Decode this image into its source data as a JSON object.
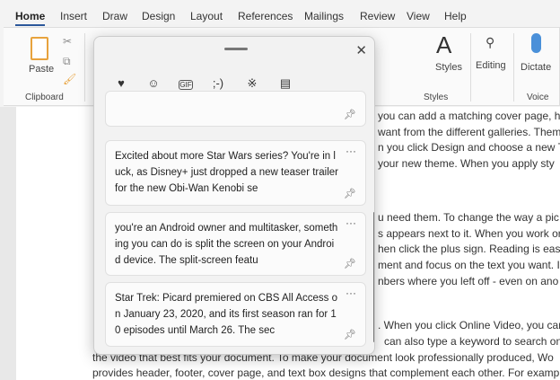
{
  "ribbon": {
    "tabs": [
      "Home",
      "Insert",
      "Draw",
      "Design",
      "Layout",
      "References",
      "Mailings",
      "Review",
      "View",
      "Help"
    ],
    "paste": "Paste",
    "clipboard": "Clipboard",
    "styles": "Styles",
    "styles_group": "Styles",
    "editing": "Editing",
    "dictate": "Dictate",
    "voice": "Voice"
  },
  "document": {
    "lines": [
      "you can add a matching cover page, he",
      "want from the different galleries. Them",
      "n you click Design and choose a new Th",
      " your new theme. When you apply sty",
      "u need them. To change the way a pic",
      "s appears next to it. When you work or",
      "hen click the plus sign. Reading is easie",
      "ment and focus on the text you want. I",
      "nbers where you left off - even on ano",
      ". When you click Online Video, you can",
      "can also type a keyword to search onl",
      "the video that best fits your document. To make your document look professionally produced, Wo",
      "provides header, footer, cover page, and text box designs that complement each other. For examp"
    ]
  },
  "clipboard_panel": {
    "categories": [
      "kaomoji-favorites",
      "emoji",
      "gif",
      "kaomoji",
      "symbols",
      "clipboard-history"
    ],
    "cat_glyphs": [
      "♥",
      "☺",
      "GIF",
      ";-)",
      "※",
      "▤"
    ],
    "items": [
      "Excited about more Star Wars series? You're in luck, as Disney+ just dropped a new teaser trailer for the new Obi-Wan Kenobi se",
      "you're an Android owner and multitasker, something you can do is split the screen on your Android device. The split-screen featu",
      "Star Trek: Picard premiered on CBS All Access on January 23, 2020, and its first season ran for 10 episodes until March 26. The sec"
    ],
    "more": "···"
  }
}
